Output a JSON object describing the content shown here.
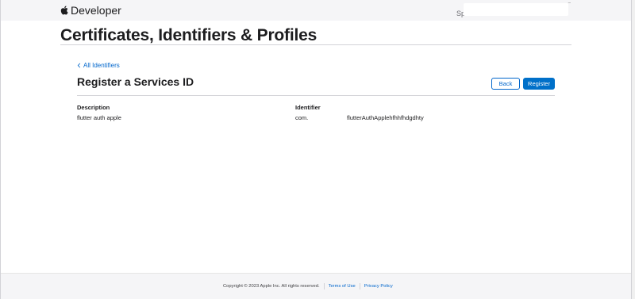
{
  "globalnav": {
    "brand_label": "Developer",
    "partial_text": "Sp"
  },
  "page": {
    "title": "Certificates, Identifiers & Profiles"
  },
  "breadcrumb": {
    "back_label": "All Identifiers"
  },
  "section": {
    "title": "Register a Services ID",
    "back_button": "Back",
    "register_button": "Register"
  },
  "fields": {
    "description_label": "Description",
    "description_value": "flutter auth apple",
    "identifier_label": "Identifier",
    "identifier_prefix": "com.",
    "identifier_value": "flutterAuthApplehfhhfhdgdhty"
  },
  "footer": {
    "copyright": "Copyright © 2023 Apple Inc. All rights reserved.",
    "terms": "Terms of Use",
    "privacy": "Privacy Policy"
  },
  "colors": {
    "accent": "#0066cc",
    "primary_button": "#0070c9",
    "nav_background": "#f5f5f7"
  },
  "icons": [
    "apple-logo-icon",
    "chevron-left-icon"
  ]
}
